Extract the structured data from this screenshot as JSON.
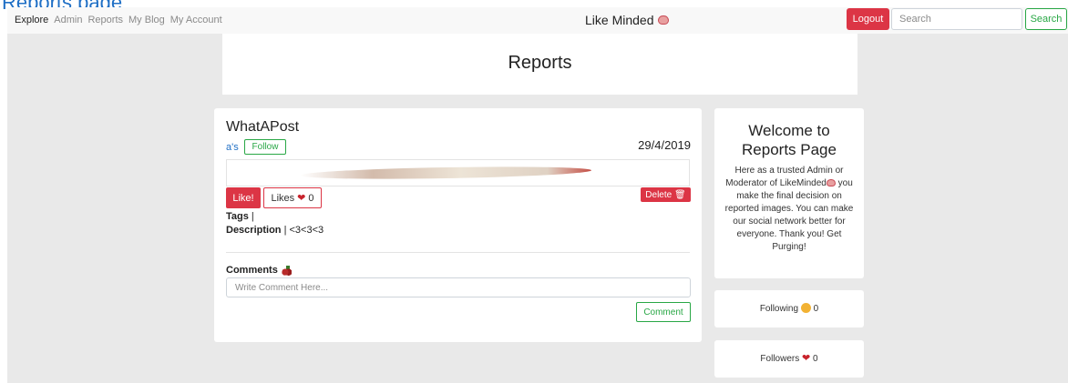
{
  "top_caption": "Reports page",
  "navbar": {
    "links": [
      "Explore",
      "Admin",
      "Reports",
      "My Blog",
      "My Account"
    ],
    "brand": "Like Minded",
    "brand_icon": "brain-icon",
    "logout_label": "Logout",
    "search_placeholder": "Search",
    "search_button": "Search"
  },
  "header": {
    "title": "Reports"
  },
  "post": {
    "title": "WhatAPost",
    "author": "a's",
    "follow_label": "Follow",
    "date": "29/4/2019",
    "like_label": "Like!",
    "likes_label": "Likes",
    "likes_count": "0",
    "delete_label": "Delete",
    "tags_label": "Tags",
    "tags_value": "|",
    "description_label": "Description",
    "description_value": "| <3<3<3",
    "comments_label": "Comments",
    "comment_placeholder": "Write Comment Here...",
    "comment_button": "Comment"
  },
  "welcome": {
    "title_line1": "Welcome to",
    "title_line2": "Reports Page",
    "text_part1": "Here as a trusted Admin or Moderator of LikeMinded",
    "text_part2": "you make the final decision on reported images. You can make our social network better for everyone. Thank you! Get Purging!"
  },
  "following": {
    "label": "Following",
    "count": "0"
  },
  "followers": {
    "label": "Followers",
    "count": "0"
  },
  "colors": {
    "danger": "#dc3545",
    "success": "#28a745",
    "link": "#1f6fc5",
    "background": "#e9e9e9"
  }
}
